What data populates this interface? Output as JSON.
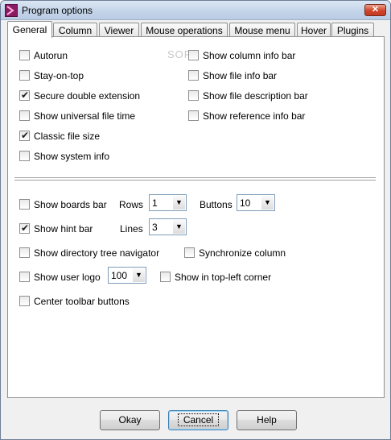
{
  "window": {
    "title": "Program options",
    "close_glyph": "✕"
  },
  "tabs": [
    {
      "label": "General",
      "active": true
    },
    {
      "label": "Column"
    },
    {
      "label": "Viewer"
    },
    {
      "label": "Mouse operations"
    },
    {
      "label": "Mouse menu"
    },
    {
      "label": "Hover"
    },
    {
      "label": "Plugins"
    }
  ],
  "watermark": "SOFT",
  "general": {
    "left_options": [
      {
        "label": "Autorun",
        "checked": false
      },
      {
        "label": "Stay-on-top",
        "checked": false
      },
      {
        "label": "Secure double extension",
        "checked": true
      },
      {
        "label": "Show universal file time",
        "checked": false
      },
      {
        "label": "Classic file size",
        "checked": true
      },
      {
        "label": "Show system info",
        "checked": false
      }
    ],
    "right_options": [
      {
        "label": "Show column info bar",
        "checked": false
      },
      {
        "label": "Show file info bar",
        "checked": false
      },
      {
        "label": "Show file description bar",
        "checked": false
      },
      {
        "label": "Show reference info bar",
        "checked": false
      }
    ],
    "show_boards_bar": {
      "label": "Show boards bar",
      "checked": false
    },
    "rows": {
      "label": "Rows",
      "value": "1"
    },
    "buttons": {
      "label": "Buttons",
      "value": "10"
    },
    "show_hint_bar": {
      "label": "Show hint bar",
      "checked": true
    },
    "lines": {
      "label": "Lines",
      "value": "3"
    },
    "show_dir_tree": {
      "label": "Show directory tree navigator",
      "checked": false
    },
    "sync_column": {
      "label": "Synchronize column",
      "checked": false
    },
    "show_user_logo": {
      "label": "Show user logo",
      "checked": false
    },
    "logo_size": {
      "value": "100"
    },
    "show_top_left": {
      "label": "Show in top-left corner",
      "checked": false
    },
    "center_toolbar": {
      "label": "Center toolbar buttons",
      "checked": false
    }
  },
  "footer": {
    "okay": "Okay",
    "cancel": "Cancel",
    "help": "Help"
  },
  "icons": {
    "check": "✔",
    "dropdown": "▼"
  }
}
